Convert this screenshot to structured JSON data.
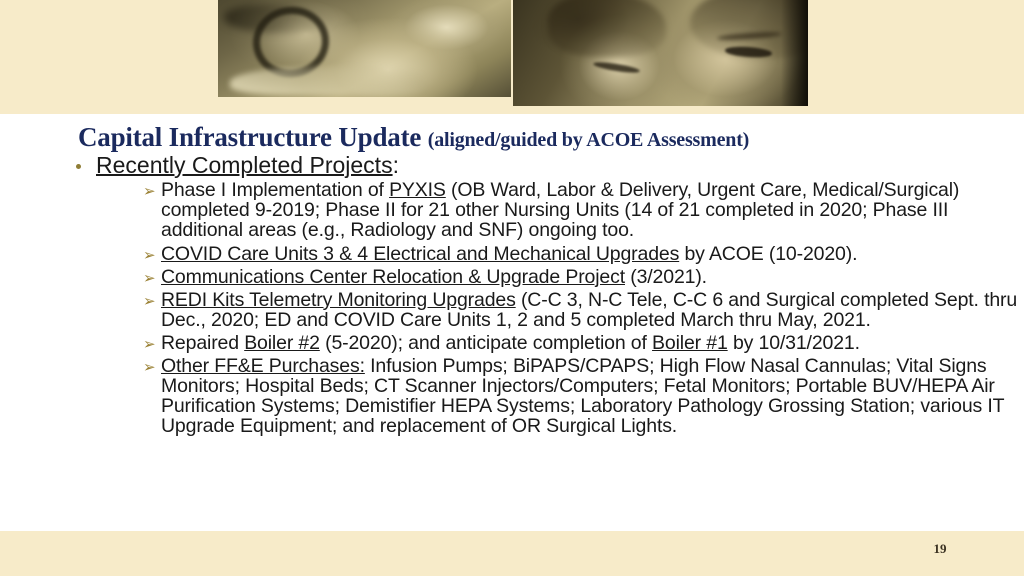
{
  "slide": {
    "page_number": "19",
    "colors": {
      "band_cream": "#f7ebc9",
      "title_navy": "#1b2a5e",
      "bullet_gold": "#8f7d35",
      "body_text": "#1a1a1a",
      "page_number": "#3b3222"
    }
  },
  "header": {
    "photo_left_alt": "sepia photo of hands resting together with bracelet",
    "photo_right_alt": "sepia photo of two women looking downward"
  },
  "title": {
    "main": "Capital Infrastructure Update ",
    "sub": "(aligned/guided by ACOE Assessment)"
  },
  "bullets": {
    "level1_label_text": "Recently Completed Projects",
    "level1_label_suffix": ":",
    "items": [
      {
        "id": "pyxis",
        "parts": [
          {
            "text": "Phase I Implementation of ",
            "underline": false
          },
          {
            "text": "PYXIS",
            "underline": true
          },
          {
            "text": " (OB Ward, Labor & Delivery, Urgent Care, Medical/Surgical) completed 9-2019; Phase II for 21 other Nursing Units (14 of 21 completed in 2020; Phase III additional areas (e.g., Radiology and SNF) ongoing too.",
            "underline": false
          }
        ]
      },
      {
        "id": "covid-care-units",
        "parts": [
          {
            "text": "COVID Care Units 3 & 4 Electrical and Mechanical Upgrades",
            "underline": true
          },
          {
            "text": " by ACOE (10-2020).",
            "underline": false
          }
        ]
      },
      {
        "id": "communications-center",
        "parts": [
          {
            "text": "Communications Center Relocation & Upgrade Project",
            "underline": true
          },
          {
            "text": " (3/2021).",
            "underline": false
          }
        ]
      },
      {
        "id": "redi-kits",
        "parts": [
          {
            "text": "REDI Kits Telemetry Monitoring Upgrades",
            "underline": true
          },
          {
            "text": " (C-C 3, N-C Tele, C-C 6 and Surgical completed Sept. thru Dec., 2020; ED  and COVID Care Units 1, 2 and 5 completed March thru May, 2021.",
            "underline": false
          }
        ]
      },
      {
        "id": "boilers",
        "parts": [
          {
            "text": "Repaired ",
            "underline": false
          },
          {
            "text": "Boiler #2",
            "underline": true
          },
          {
            "text": " (5-2020); and anticipate completion of ",
            "underline": false
          },
          {
            "text": "Boiler #1",
            "underline": true
          },
          {
            "text": " by 10/31/2021.",
            "underline": false
          }
        ]
      },
      {
        "id": "other-ffe",
        "parts": [
          {
            "text": "Other FF&E Purchases:",
            "underline": true
          },
          {
            "text": "  Infusion Pumps; BiPAPS/CPAPS; High Flow Nasal Cannulas; Vital Signs Monitors; Hospital Beds; CT Scanner Injectors/Computers; Fetal Monitors; Portable BUV/HEPA Air Purification Systems; Demistifier HEPA Systems; Laboratory Pathology Grossing Station; various IT Upgrade Equipment; and replacement of OR Surgical Lights.",
            "underline": false
          }
        ]
      }
    ]
  },
  "icons": {
    "level1_bullet": "round-dot-bullet-icon",
    "level2_bullet": "arrowhead-bullet-icon"
  }
}
